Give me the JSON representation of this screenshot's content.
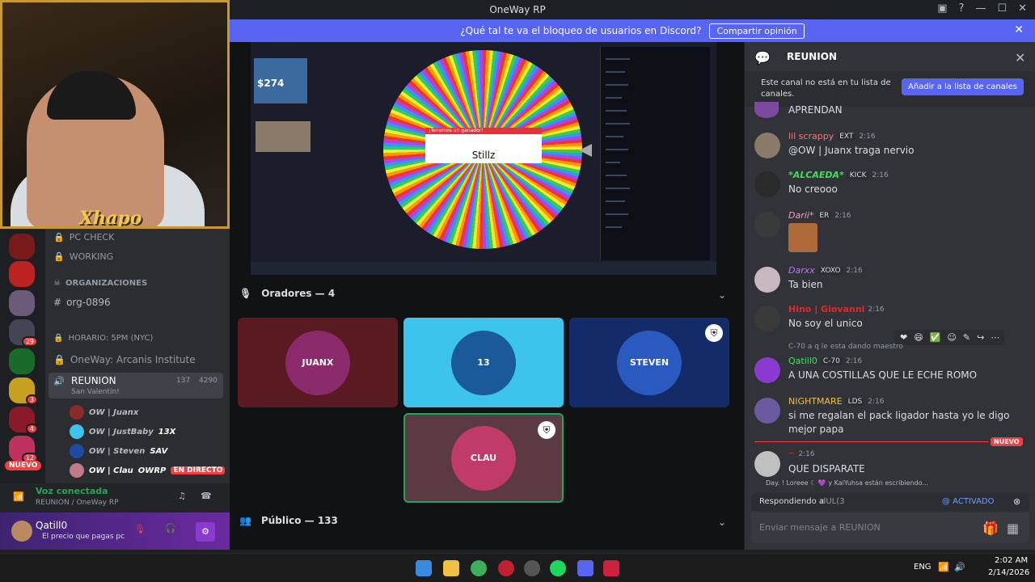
{
  "window": {
    "title": "OneWay RP"
  },
  "banner": {
    "text": "¿Qué tal te va el bloqueo de usuarios en Discord?",
    "button": "Compartir opinión"
  },
  "webcam": {
    "name_overlay": "Xhapo"
  },
  "servers": {
    "badges": [
      "29",
      "3",
      "4",
      "12"
    ],
    "nuevo": "NUEVO"
  },
  "channels": {
    "pc_check": "PC CHECK",
    "working": "WORKING",
    "category": "ORGANIZACIONES",
    "org": "org-0896",
    "horario": "HORARIO: 5PM (NYC)",
    "institute": "OneWay: Arcanis Institute",
    "voice_channel": "REUNION",
    "voice_sub": "San Valentin!",
    "voice_count": "137",
    "voice_count2": "4290",
    "voice_users": [
      {
        "name": "OW | Juanx",
        "tag": ""
      },
      {
        "name": "OW | JustBaby",
        "tag": "13X"
      },
      {
        "name": "OW | Steven",
        "tag": "SAV"
      },
      {
        "name": "OW | Clau",
        "tag": "OWRP"
      }
    ],
    "live_label": "EN DIRECTO"
  },
  "voice_status": {
    "title": "Voz conectada",
    "channel": "REUNION / OneWay RP"
  },
  "user": {
    "name": "Qatill0",
    "status": "El precio que pagas pc"
  },
  "stream": {
    "popup_title": "¡Tenemos un ganador!",
    "winner": "Stillz",
    "price": "$274"
  },
  "speakers": {
    "label": "Oradores — 4"
  },
  "tiles": [
    {
      "logo": "JUANX",
      "color": "#5a1a22"
    },
    {
      "logo": "13",
      "color": "#3cc4ec"
    },
    {
      "logo": "STEVEN",
      "color": "#142b6a"
    },
    {
      "logo": "CLAU",
      "color": "#5c3a44"
    }
  ],
  "public": {
    "label": "Público — 133"
  },
  "chat": {
    "channel": "REUNION",
    "notice": "Este canal no está en tu lista de canales.",
    "add_button": "Añadir a la lista de canales",
    "messages": [
      {
        "author": "",
        "time": "",
        "text": "APRENDAN"
      },
      {
        "author": "lil scrappy",
        "badge": "EXT",
        "time": "2:16",
        "text": "@OW | Juanx traga nervio"
      },
      {
        "author": "*ALCAEDA*",
        "badge": "KICK",
        "time": "2:16",
        "text": "No creooo"
      },
      {
        "author": "Darii*",
        "badge": "ER",
        "time": "2:16",
        "text": ""
      },
      {
        "author": "Darxx",
        "badge": "XOXO",
        "time": "2:16",
        "text": "Ta bien"
      },
      {
        "author": "Hino | Giovanni",
        "badge": "",
        "time": "2:16",
        "text": "No soy el unico"
      },
      {
        "author": "Qatill0",
        "badge": "C-70",
        "time": "2:16",
        "text": "A UNA COSTILLAS QUE LE ECHE ROMO",
        "reply": "a q le esta dando maestro",
        "reply_badge": "C-70"
      },
      {
        "author": "NIGHTMARE",
        "badge": "LDS",
        "time": "2:16",
        "text": "si me regalan el pack ligador hasta yo le digo mejor papa"
      },
      {
        "author": "",
        "badge": "",
        "time": "2:16",
        "text": "QUE DISPARATE"
      }
    ],
    "new_label": "NUEVO",
    "typing": "Day. ! Loreee ☾ 💜 y KaiYuhsa están escribiendo...",
    "replying_to": "Respondiendo a",
    "replying_name": "dUL(3",
    "activated": "@ ACTIVADO",
    "input_placeholder": "Enviar mensaje a REUNION"
  },
  "taskbar": {
    "lang": "ENG",
    "time": "2:02 AM",
    "date": "2/14/2026"
  }
}
